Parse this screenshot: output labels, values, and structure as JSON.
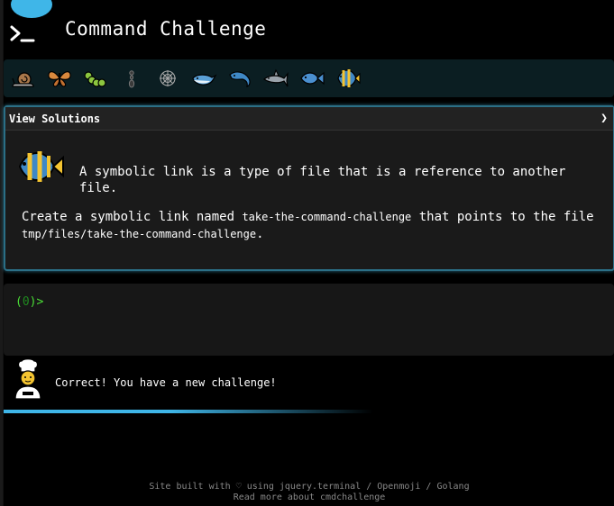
{
  "header": {
    "title": "Command Challenge"
  },
  "badges": [
    {
      "icon": "snail-icon"
    },
    {
      "icon": "butterfly-icon"
    },
    {
      "icon": "caterpillar-icon"
    },
    {
      "icon": "ant-icon"
    },
    {
      "icon": "spider-web-icon"
    },
    {
      "icon": "whale-icon"
    },
    {
      "icon": "dolphin-icon"
    },
    {
      "icon": "shark-icon"
    },
    {
      "icon": "fish-icon"
    },
    {
      "icon": "tropical-fish-icon"
    }
  ],
  "panel": {
    "solutions_label": "View Solutions",
    "solutions_chevron": "❯",
    "description": "A symbolic link is a type of file that is a reference to another file.",
    "task_prefix": "Create a symbolic link named ",
    "task_link_name": "take-the-command-challenge",
    "task_middle": " that points to the file ",
    "task_target": "tmp/files/take-the-command-challenge",
    "task_suffix": "."
  },
  "terminal": {
    "prompt_open": "(",
    "prompt_num": "0",
    "prompt_close": ")>"
  },
  "result": {
    "message": "Correct! You have a new challenge!",
    "progress": 0.6
  },
  "footer": {
    "line1_a": "Site built with ",
    "heart": "♡",
    "line1_b": " using jquery.terminal / Openmoji / Golang",
    "line2": "Read more about cmdchallenge"
  },
  "colors": {
    "accent": "#3fb6e8",
    "prompt": "#4ade36",
    "panel_border": "#2b6f86"
  }
}
